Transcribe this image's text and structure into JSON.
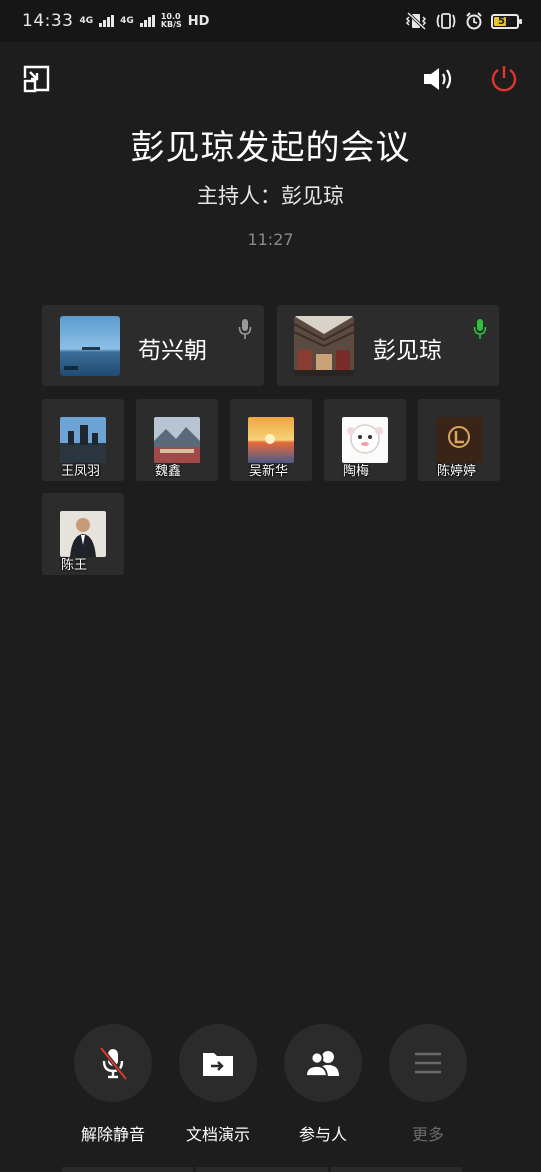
{
  "status_bar": {
    "time": "14:33",
    "net_type_1": "4G",
    "net_type_2": "4G",
    "net_speed": "10.0",
    "net_speed_unit": "KB/S",
    "hd_label": "HD",
    "battery_level": "52"
  },
  "meeting": {
    "title": "彭见琼发起的会议",
    "host_line": "主持人：彭见琼",
    "duration": "11:27"
  },
  "featured_participants": [
    {
      "name": "苟兴朝",
      "mic_state": "idle",
      "mic_color": "#9a9a9a"
    },
    {
      "name": "彭见琼",
      "mic_state": "speaking",
      "mic_color": "#2fbf3c"
    }
  ],
  "participants": [
    {
      "name": "王凤羽"
    },
    {
      "name": "魏鑫"
    },
    {
      "name": "吴新华"
    },
    {
      "name": "陶梅"
    },
    {
      "name": "陈婷婷"
    },
    {
      "name": "陈王"
    }
  ],
  "toolbar": {
    "unmute_label": "解除静音",
    "share_doc_label": "文档演示",
    "participants_label": "参与人",
    "more_label": "更多"
  },
  "colors": {
    "background": "#1d1d1d",
    "card": "#2c2c2c",
    "power_red": "#e0352b",
    "mute_slash": "#d83a2e",
    "speaking_green": "#2fbf3c"
  },
  "icons": {
    "minimize": "minimize-window-icon",
    "speaker": "speaker-icon",
    "power": "power-icon",
    "mic_off": "mic-off-icon",
    "share": "share-document-icon",
    "people": "participants-icon",
    "more": "menu-icon"
  }
}
